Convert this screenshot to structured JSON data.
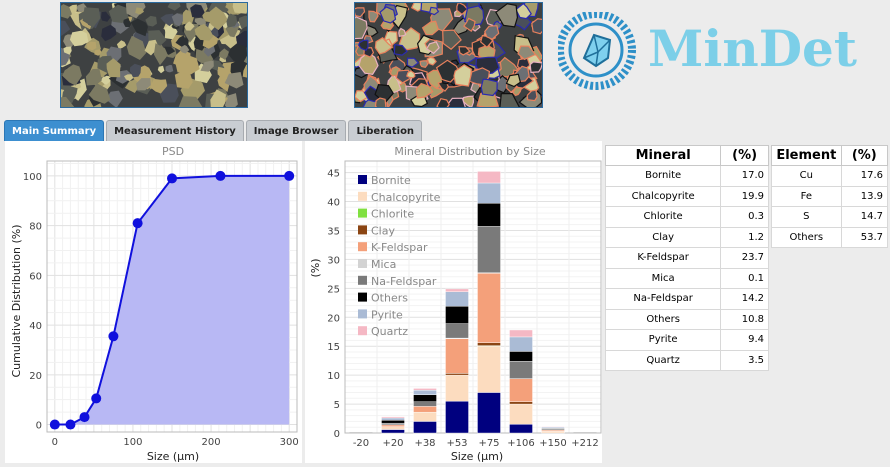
{
  "logo": {
    "text": "MinDet"
  },
  "tabs": [
    {
      "label": "Main Summary",
      "active": true
    },
    {
      "label": "Measurement History",
      "active": false
    },
    {
      "label": "Image Browser",
      "active": false
    },
    {
      "label": "Liberation",
      "active": false
    }
  ],
  "psd_chart": {
    "type": "line",
    "title": "PSD",
    "xlabel": "Size (µm)",
    "ylabel": "Cumulative Distribution (%)",
    "xlim": [
      -10,
      310
    ],
    "ylim": [
      -3,
      106
    ],
    "xticks": [
      0,
      100,
      200,
      300
    ],
    "yticks": [
      0,
      20,
      40,
      60,
      80,
      100
    ],
    "x": [
      0,
      20,
      38,
      53,
      75,
      106,
      150,
      212,
      300
    ],
    "y": [
      0,
      0,
      3,
      10.5,
      35.5,
      81,
      99,
      100,
      100
    ],
    "color": "#1010dd",
    "fill": "#b8b8f4"
  },
  "mineral_chart": {
    "type": "bar",
    "stacked": true,
    "title": "Mineral Distribution by Size",
    "xlabel": "Size (µm)",
    "ylabel": "(%)",
    "ylim": [
      0,
      47
    ],
    "yticks": [
      0,
      5,
      10,
      15,
      20,
      25,
      30,
      35,
      40,
      45
    ],
    "categories": [
      "-20",
      "+20",
      "+38",
      "+53",
      "+75",
      "+106",
      "+150",
      "+212"
    ],
    "legend_position": "top-left",
    "series": [
      {
        "name": "Bornite",
        "color": "#00007f",
        "values": [
          0,
          0.6,
          2.0,
          5.5,
          7.0,
          1.5,
          0,
          0
        ]
      },
      {
        "name": "Chalcopyrite",
        "color": "#fcdcbf",
        "values": [
          0,
          0.5,
          1.6,
          4.5,
          8.0,
          3.5,
          0.3,
          0
        ]
      },
      {
        "name": "Chlorite",
        "color": "#80e040",
        "values": [
          0,
          0,
          0,
          0,
          0.1,
          0,
          0,
          0
        ]
      },
      {
        "name": "Clay",
        "color": "#8b4513",
        "values": [
          0,
          0,
          0,
          0.3,
          0.5,
          0.4,
          0,
          0
        ]
      },
      {
        "name": "K-Feldspar",
        "color": "#f4a07a",
        "values": [
          0,
          0.3,
          1.0,
          6.0,
          12.0,
          4.0,
          0.2,
          0
        ]
      },
      {
        "name": "Mica",
        "color": "#d3d3d3",
        "values": [
          0,
          0,
          0,
          0.1,
          0.1,
          0,
          0,
          0
        ]
      },
      {
        "name": "Na-Feldspar",
        "color": "#7a7a7a",
        "values": [
          0,
          0.3,
          0.8,
          2.5,
          8.0,
          3.0,
          0.2,
          0
        ]
      },
      {
        "name": "Others",
        "color": "#000000",
        "values": [
          0,
          0.5,
          1.2,
          3.0,
          4.0,
          1.7,
          0.1,
          0
        ]
      },
      {
        "name": "Pyrite",
        "color": "#aabbd5",
        "values": [
          0,
          0.4,
          0.8,
          2.5,
          3.5,
          2.5,
          0.2,
          0
        ]
      },
      {
        "name": "Quartz",
        "color": "#f5b8c4",
        "values": [
          0,
          0.2,
          0.3,
          0.5,
          2.0,
          1.2,
          0.1,
          0
        ]
      }
    ]
  },
  "mineral_table": {
    "headers": [
      "Mineral",
      "(%)"
    ],
    "rows": [
      [
        "Bornite",
        "17.0"
      ],
      [
        "Chalcopyrite",
        "19.9"
      ],
      [
        "Chlorite",
        "0.3"
      ],
      [
        "Clay",
        "1.2"
      ],
      [
        "K-Feldspar",
        "23.7"
      ],
      [
        "Mica",
        "0.1"
      ],
      [
        "Na-Feldspar",
        "14.2"
      ],
      [
        "Others",
        "10.8"
      ],
      [
        "Pyrite",
        "9.4"
      ],
      [
        "Quartz",
        "3.5"
      ]
    ]
  },
  "element_table": {
    "headers": [
      "Element",
      "(%)"
    ],
    "rows": [
      [
        "Cu",
        "17.6"
      ],
      [
        "Fe",
        "13.9"
      ],
      [
        "S",
        "14.7"
      ],
      [
        "Others",
        "53.7"
      ]
    ]
  }
}
